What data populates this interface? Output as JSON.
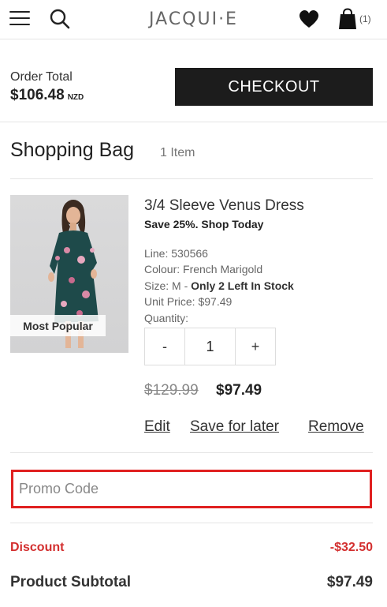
{
  "header": {
    "brand": "JACQUI·E",
    "bag_count": "(1)"
  },
  "order": {
    "total_label": "Order Total",
    "total_amount": "$106.48",
    "currency": "NZD",
    "checkout_label": "CHECKOUT"
  },
  "bag": {
    "title": "Shopping Bag",
    "item_count": "1 Item"
  },
  "product": {
    "badge": "Most Popular",
    "name": "3/4 Sleeve Venus Dress",
    "promo": "Save 25%. Shop Today",
    "line": "Line: 530566",
    "colour": "Colour: French Marigold",
    "size_prefix": "Size: M - ",
    "stock": "Only 2 Left In Stock",
    "unit_price": "Unit Price: $97.49",
    "quantity_label": "Quantity:",
    "qty_minus": "-",
    "qty_value": "1",
    "qty_plus": "+",
    "price_old": "$129.99",
    "price_new": "$97.49"
  },
  "actions": {
    "edit": "Edit",
    "save_later": "Save for later",
    "remove": "Remove"
  },
  "promo": {
    "placeholder": "Promo Code"
  },
  "summary": {
    "discount_label": "Discount",
    "discount_value": "-$32.50",
    "subtotal_label": "Product Subtotal",
    "subtotal_value": "$97.49"
  },
  "colors": {
    "accent_red": "#d32f2f",
    "checkout_bg": "#1c1c1c",
    "promo_border": "#e02020"
  },
  "icons": [
    "hamburger-menu-icon",
    "search-icon",
    "heart-icon",
    "shopping-bag-icon"
  ]
}
